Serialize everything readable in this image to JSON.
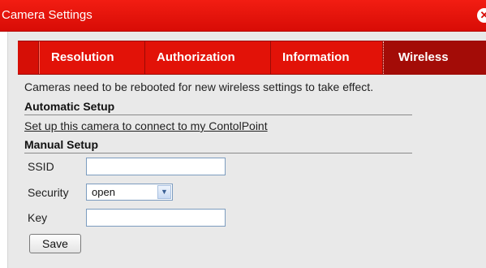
{
  "dialog": {
    "title": "Camera Settings",
    "close_icon": "close-icon"
  },
  "tabs": [
    {
      "label": "Resolution",
      "active": false
    },
    {
      "label": "Authorization",
      "active": false
    },
    {
      "label": "Information",
      "active": false
    },
    {
      "label": "Wireless",
      "active": true
    }
  ],
  "notice": "Cameras need to be rebooted for new wireless settings to take effect.",
  "automatic": {
    "heading": "Automatic Setup",
    "link": "Set up this camera to connect to my ContolPoint"
  },
  "manual": {
    "heading": "Manual Setup",
    "ssid_label": "SSID",
    "ssid_value": "",
    "security_label": "Security",
    "security_value": "open",
    "key_label": "Key",
    "key_value": "",
    "save_label": "Save"
  },
  "colors": {
    "title_bar": "#d80c06",
    "tab_bar": "#e21208",
    "active_tab": "#a30c07",
    "panel_bg": "#e9e9e9"
  }
}
